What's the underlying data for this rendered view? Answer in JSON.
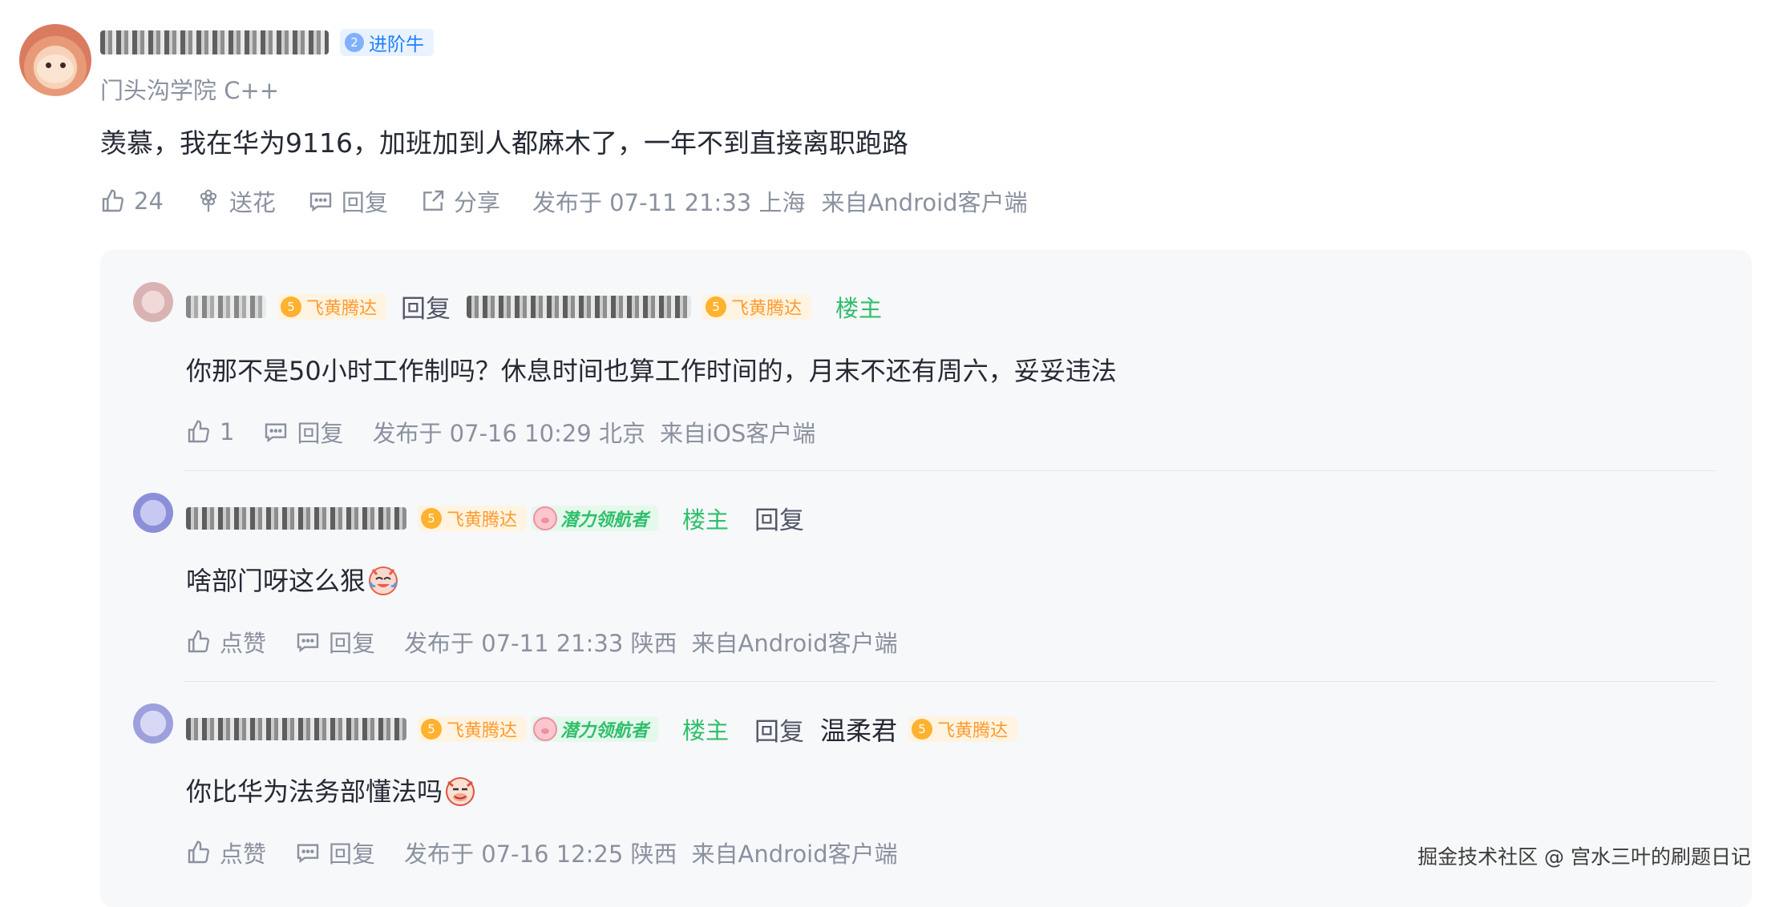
{
  "comment": {
    "level_number": "2",
    "level_label": "进阶牛",
    "subtitle": "门头沟学院 C++",
    "content": "羡慕，我在华为9116，加班加到人都麻木了，一年不到直接离职跑路",
    "actions": {
      "likes": "24",
      "send_flower": "送花",
      "reply": "回复",
      "share": "分享"
    },
    "published": "发布于 07-11 21:33 上海",
    "client": "来自Android客户端"
  },
  "replies": [
    {
      "badge_number": "5",
      "badge_label": "飞黄腾达",
      "reply_word": "回复",
      "target_badge_number": "5",
      "target_badge_label": "飞黄腾达",
      "owner_label": "楼主",
      "content": "你那不是50小时工作制吗？休息时间也算工作时间的，月末不还有周六，妥妥违法",
      "like_text": "1",
      "reply_label": "回复",
      "published": "发布于 07-16 10:29 北京",
      "client": "来自iOS客户端"
    },
    {
      "badge_number": "5",
      "badge_label": "飞黄腾达",
      "potential_label": "潜力领航者",
      "owner_label": "楼主",
      "reply_word": "回复",
      "content": "啥部门呀这么狠",
      "like_text": "点赞",
      "reply_label": "回复",
      "published": "发布于 07-11 21:33 陕西",
      "client": "来自Android客户端"
    },
    {
      "badge_number": "5",
      "badge_label": "飞黄腾达",
      "potential_label": "潜力领航者",
      "owner_label": "楼主",
      "reply_word": "回复",
      "target_name": "温柔君",
      "target_badge_number": "5",
      "target_badge_label": "飞黄腾达",
      "content": "你比华为法务部懂法吗",
      "like_text": "点赞",
      "reply_label": "回复",
      "published": "发布于 07-16 12:25 陕西",
      "client": "来自Android客户端"
    }
  ],
  "watermark": "掘金技术社区 @ 宫水三叶的刷题日记",
  "colors": {
    "owner_green": "#2fbf6b",
    "gold": "#ff9a2e",
    "level_blue": "#1e80ff",
    "meta_gray": "#8a919f"
  }
}
